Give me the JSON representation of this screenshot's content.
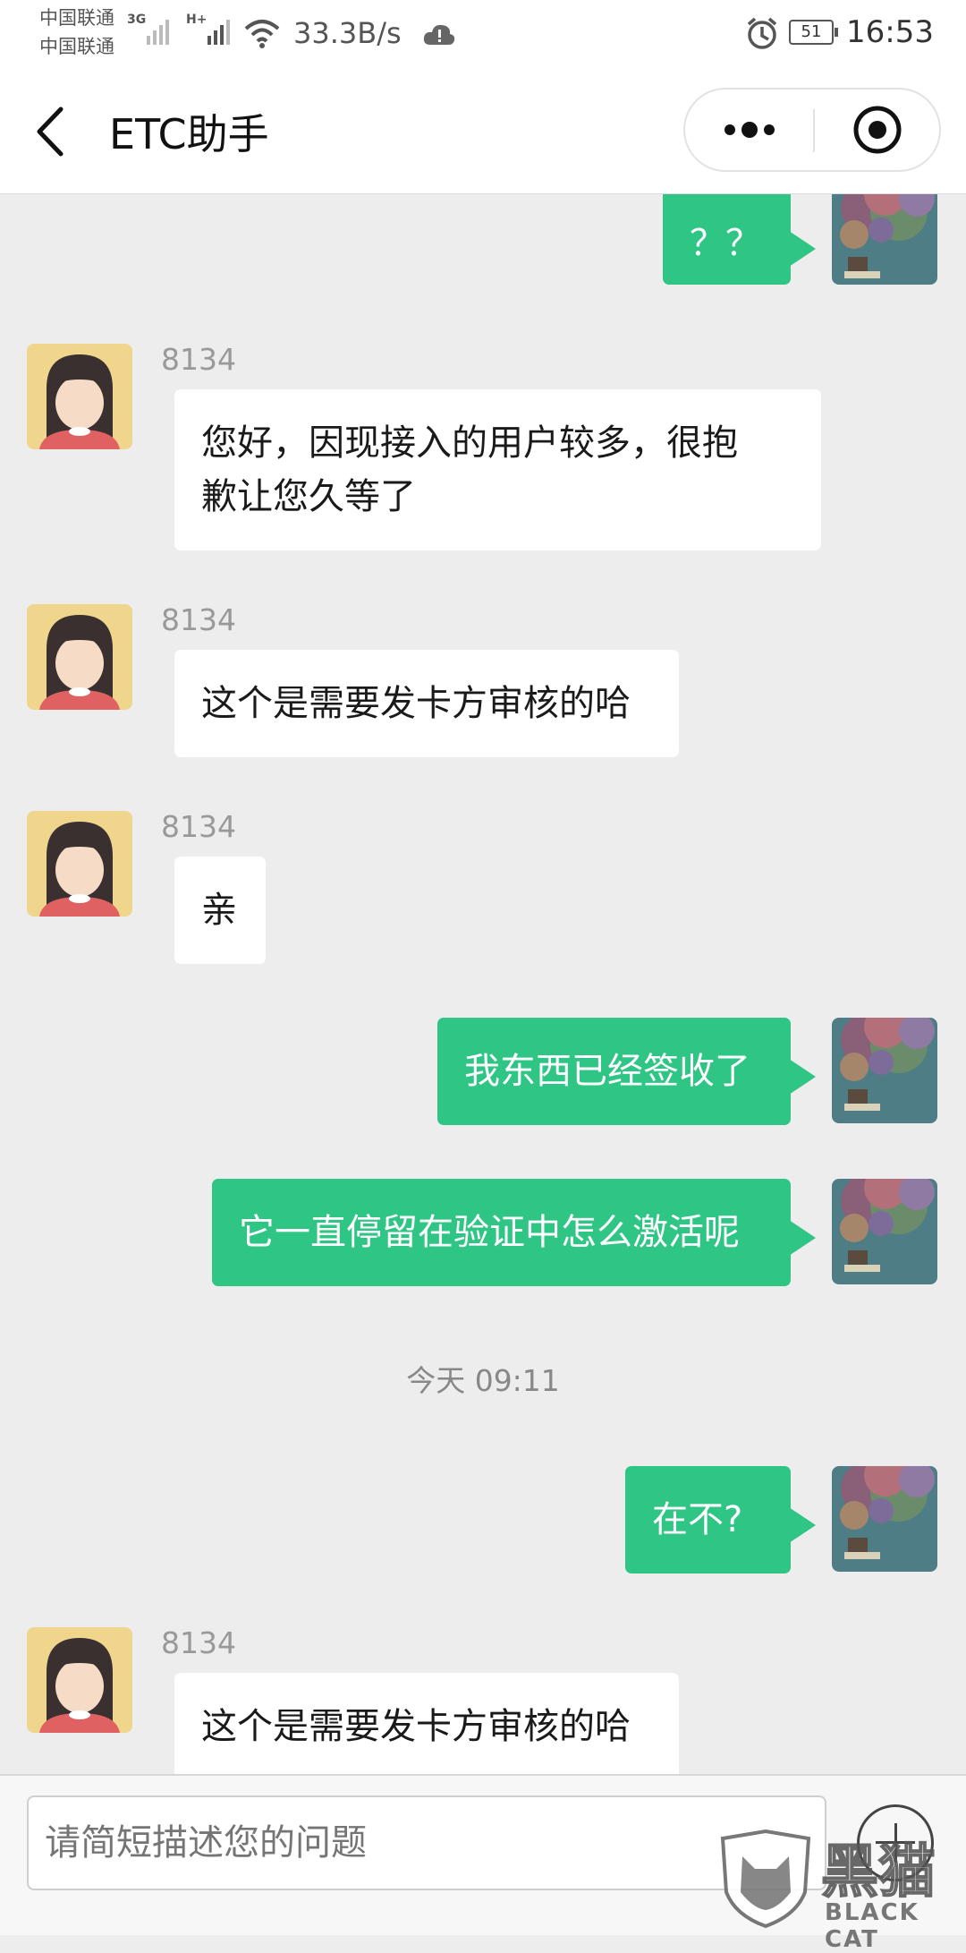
{
  "status_bar": {
    "carrier_1": "中国联通",
    "carrier_2": "中国联通",
    "network_1": "3G",
    "network_2": "H+",
    "speed": "33.3B/s",
    "battery": "51",
    "time": "16:53",
    "icons": [
      "signal-icon",
      "wifi-icon",
      "cloud-alert-icon",
      "alarm-icon",
      "battery-icon"
    ]
  },
  "header": {
    "title": "ETC助手",
    "icons": [
      "back-arrow-icon",
      "more-dots-icon",
      "target-close-icon"
    ]
  },
  "messages": [
    {
      "from": "me",
      "text": "？？"
    },
    {
      "from": "agent",
      "name": "8134",
      "lines": [
        "您好，因现接入的用户较多，很抱",
        "歉让您久等了"
      ]
    },
    {
      "from": "agent",
      "name": "8134",
      "text": "这个是需要发卡方审核的哈"
    },
    {
      "from": "agent",
      "name": "8134",
      "text": "亲"
    },
    {
      "from": "me",
      "text": "我东西已经签收了"
    },
    {
      "from": "me",
      "text": "它一直停留在验证中怎么激活呢"
    },
    {
      "type": "timestamp",
      "text": "今天 09:11"
    },
    {
      "from": "me",
      "text": "在不?"
    },
    {
      "from": "agent",
      "name": "8134",
      "text": "这个是需要发卡方审核的哈"
    }
  ],
  "input": {
    "placeholder": "请简短描述您的问题"
  },
  "watermark": {
    "text": "黑猫",
    "sub": "BLACK CAT"
  },
  "colors": {
    "outgoing_bubble": "#2fc585",
    "incoming_bubble": "#ffffff",
    "chat_background": "#ededed"
  }
}
